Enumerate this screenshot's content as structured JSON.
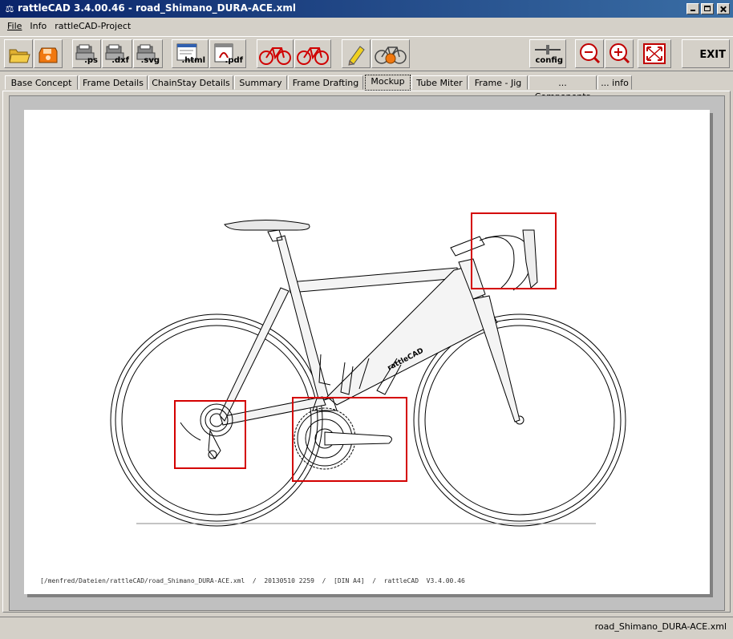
{
  "window": {
    "title": "rattleCAD  3.4.00.46 - road_Shimano_DURA-ACE.xml",
    "app_icon": "bicycle-icon"
  },
  "menu": [
    "File",
    "Info",
    "rattleCAD-Project"
  ],
  "toolbar": {
    "open": {
      "icon": "open-folder-icon"
    },
    "save": {
      "icon": "save-disk-icon"
    },
    "ps": {
      "label": ".ps",
      "icon": "printer-icon"
    },
    "dxf": {
      "label": ".dxf",
      "icon": "printer-icon"
    },
    "svg": {
      "label": ".svg",
      "icon": "printer-icon"
    },
    "html": {
      "label": ".html",
      "icon": "html-page-icon"
    },
    "pdf": {
      "label": ".pdf",
      "icon": "pdf-page-icon"
    },
    "bike_red": {
      "icon": "bicycle-red-icon"
    },
    "bike_red2": {
      "icon": "bicycle-red-icon"
    },
    "pencil": {
      "icon": "pencil-icon"
    },
    "bike_render": {
      "icon": "bicycle-render-icon"
    },
    "config": {
      "label": "config",
      "icon": "config-slider-icon"
    },
    "zoom_out": {
      "icon": "zoom-out-icon"
    },
    "zoom_in": {
      "icon": "zoom-in-icon"
    },
    "fit": {
      "icon": "fit-to-window-icon"
    },
    "exit": {
      "label": "EXIT"
    }
  },
  "tabs": [
    {
      "label": "Base Concept"
    },
    {
      "label": "Frame Details"
    },
    {
      "label": "ChainStay Details"
    },
    {
      "label": "Summary"
    },
    {
      "label": "Frame Drafting"
    },
    {
      "label": "Mockup",
      "active": true
    },
    {
      "label": "Tube Miter"
    },
    {
      "label": "Frame - Jig"
    },
    {
      "label": "... Components"
    },
    {
      "label": "... info"
    }
  ],
  "drawing": {
    "footer": "[/menfred/Dateien/rattleCAD/road_Shimano_DURA-ACE.xml  /  20130510 2259  /  [DIN A4]  /  rattleCAD  V3.4.00.46",
    "downtube_decal": "rattleCAD",
    "highlight_color": "#d40000",
    "frame_color": "#f4f4f4",
    "line_color": "#000000"
  },
  "status": "road_Shimano_DURA-ACE.xml"
}
